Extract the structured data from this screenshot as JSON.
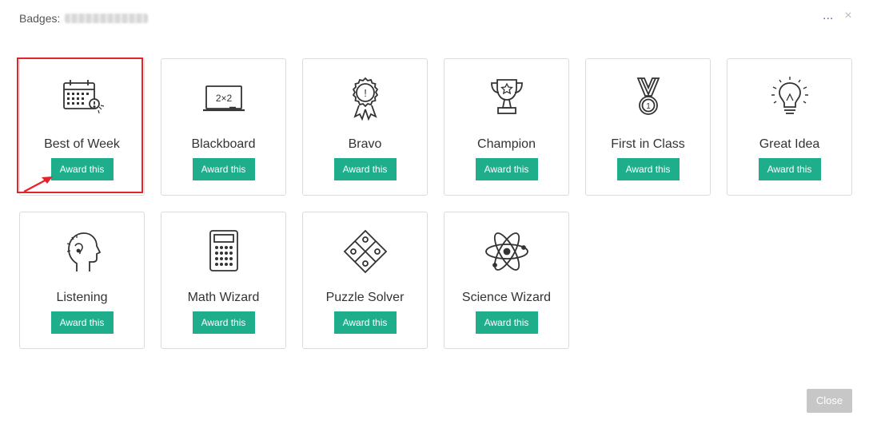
{
  "header": {
    "label": "Badges:",
    "more_label": "...",
    "close_symbol": "×"
  },
  "badges": [
    {
      "name": "Best of Week",
      "icon": "calendar-star-icon",
      "award_label": "Award this"
    },
    {
      "name": "Blackboard",
      "icon": "blackboard-icon",
      "award_label": "Award this",
      "board_text": "2×2"
    },
    {
      "name": "Bravo",
      "icon": "rosette-icon",
      "award_label": "Award this",
      "rosette_text": "!"
    },
    {
      "name": "Champion",
      "icon": "trophy-icon",
      "award_label": "Award this"
    },
    {
      "name": "First in Class",
      "icon": "medal-icon",
      "award_label": "Award this",
      "medal_text": "1"
    },
    {
      "name": "Great Idea",
      "icon": "lightbulb-icon",
      "award_label": "Award this"
    },
    {
      "name": "Listening",
      "icon": "head-listening-icon",
      "award_label": "Award this"
    },
    {
      "name": "Math Wizard",
      "icon": "calculator-icon",
      "award_label": "Award this"
    },
    {
      "name": "Puzzle Solver",
      "icon": "puzzle-icon",
      "award_label": "Award this"
    },
    {
      "name": "Science Wizard",
      "icon": "atom-icon",
      "award_label": "Award this"
    }
  ],
  "footer": {
    "close_label": "Close"
  },
  "colors": {
    "award_button": "#1fae8b",
    "highlight": "#e3242b",
    "close_button": "#c7c7c7"
  }
}
